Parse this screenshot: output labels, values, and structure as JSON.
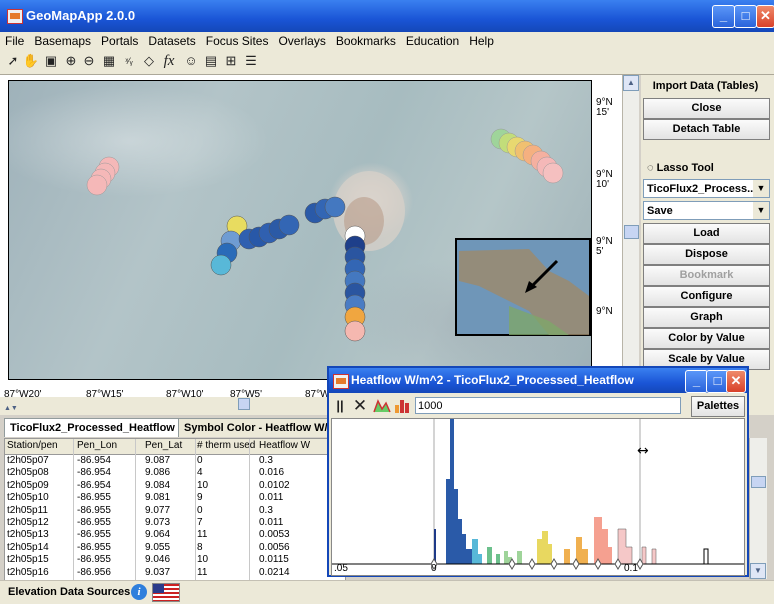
{
  "window": {
    "title": "GeoMapApp 2.0.0"
  },
  "menu": [
    "File",
    "Basemaps",
    "Portals",
    "Datasets",
    "Focus Sites",
    "Overlays",
    "Bookmarks",
    "Education",
    "Help"
  ],
  "toolbar": {
    "icons": [
      "pointer-icon",
      "hand-icon",
      "save-icon",
      "zoom-in-icon",
      "zoom-out-icon",
      "grid-icon",
      "profile-icon",
      "lasso-icon",
      "function-icon",
      "contour-icon",
      "window-icon",
      "table-icon",
      "list-icon"
    ]
  },
  "map": {
    "lat_labels": [
      "9°N\n15'",
      "9°N\n10'",
      "9°N\n5'",
      "9°N"
    ],
    "lon_labels": [
      "87°W20'",
      "87°W15'",
      "87°W10'",
      "87°W5'",
      "87°W"
    ]
  },
  "right_panel": {
    "import": "Import Data (Tables)",
    "close": "Close",
    "detach": "Detach Table",
    "lasso": "Lasso Tool",
    "layer_select": "TicoFlux2_Process...",
    "save_select": "Save",
    "load": "Load",
    "dispose": "Dispose",
    "bookmark": "Bookmark",
    "configure": "Configure",
    "graph": "Graph",
    "color_by_value": "Color by Value",
    "scale_by_value": "Scale by Value"
  },
  "tabs": [
    "TicoFlux2_Processed_Heatflow",
    "Symbol Color - Heatflow W/m"
  ],
  "table": {
    "columns": [
      "Station/pen",
      "Pen_Lon",
      "Pen_Lat",
      "# therm used",
      "Heatflow W"
    ],
    "rows": [
      [
        "t2h05p07",
        "-86.954",
        "9.087",
        "0",
        "0.3"
      ],
      [
        "t2h05p08",
        "-86.954",
        "9.086",
        "4",
        "0.016"
      ],
      [
        "t2h05p09",
        "-86.954",
        "9.084",
        "10",
        "0.0102"
      ],
      [
        "t2h05p10",
        "-86.955",
        "9.081",
        "9",
        "0.011"
      ],
      [
        "t2h05p11",
        "-86.955",
        "9.077",
        "0",
        "0.3"
      ],
      [
        "t2h05p12",
        "-86.955",
        "9.073",
        "7",
        "0.011"
      ],
      [
        "t2h05p13",
        "-86.955",
        "9.064",
        "11",
        "0.0053"
      ],
      [
        "t2h05p14",
        "-86.955",
        "9.055",
        "8",
        "0.0056"
      ],
      [
        "t2h05p15",
        "-86.955",
        "9.046",
        "10",
        "0.0115"
      ],
      [
        "t2h05p16",
        "-86.956",
        "9.037",
        "11",
        "0.0214"
      ]
    ]
  },
  "status": {
    "label": "Elevation Data Sources"
  },
  "heatflow_window": {
    "title": "Heatflow W/m^2 - TicoFlux2_Processed_Heatflow",
    "value_field": "1000",
    "palettes_button": "Palettes",
    "axis_labels": [
      ".05",
      "0",
      "0.1"
    ]
  },
  "colors": {
    "accent": "#1a55d6",
    "close": "#d8412a"
  }
}
